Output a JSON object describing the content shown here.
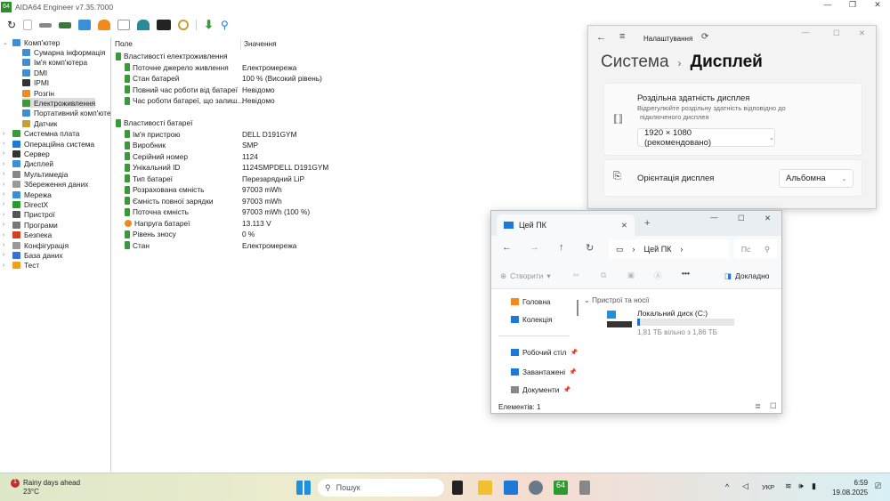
{
  "app": {
    "title": "AIDA64 Engineer v7.35.7000",
    "logo": "64"
  },
  "tree": [
    {
      "label": "Комп'ютер",
      "level": 0,
      "expanded": true,
      "color": "#3a8fd6"
    },
    {
      "label": "Сумарна інформація",
      "level": 1,
      "color": "#3a8fd6"
    },
    {
      "label": "Ім'я комп'ютера",
      "level": 1,
      "color": "#3a8fd6"
    },
    {
      "label": "DMI",
      "level": 1,
      "color": "#3a8fd6"
    },
    {
      "label": "IPMI",
      "level": 1,
      "color": "#333"
    },
    {
      "label": "Розгін",
      "level": 1,
      "color": "#f08a1e"
    },
    {
      "label": "Електроживлення",
      "level": 1,
      "selected": true,
      "color": "#3a9a3a"
    },
    {
      "label": "Портативний комп'юте",
      "level": 1,
      "color": "#3a8fd6"
    },
    {
      "label": "Датчик",
      "level": 1,
      "color": "#c8a030"
    },
    {
      "label": "Системна плата",
      "level": 0,
      "color": "#3a9a3a"
    },
    {
      "label": "Операційна система",
      "level": 0,
      "color": "#1e78d6"
    },
    {
      "label": "Сервер",
      "level": 0,
      "color": "#333"
    },
    {
      "label": "Дисплей",
      "level": 0,
      "color": "#3a8fd6"
    },
    {
      "label": "Мультимедіа",
      "level": 0,
      "color": "#888"
    },
    {
      "label": "Збереження даних",
      "level": 0,
      "color": "#999"
    },
    {
      "label": "Мережа",
      "level": 0,
      "color": "#3a8fd6"
    },
    {
      "label": "DirectX",
      "level": 0,
      "color": "#2a9a2a"
    },
    {
      "label": "Пристрої",
      "level": 0,
      "color": "#555"
    },
    {
      "label": "Програми",
      "level": 0,
      "color": "#777"
    },
    {
      "label": "Безпека",
      "level": 0,
      "color": "#d04020"
    },
    {
      "label": "Конфігурація",
      "level": 0,
      "color": "#999"
    },
    {
      "label": "База даних",
      "level": 0,
      "color": "#3a6fd6"
    },
    {
      "label": "Тест",
      "level": 0,
      "color": "#f0a020"
    }
  ],
  "list": {
    "columns": [
      "Поле",
      "Значення"
    ],
    "rows": [
      {
        "field": "Властивості електроживлення",
        "value": "",
        "group": true
      },
      {
        "field": "Поточне джерело живлення",
        "value": "Електромережа"
      },
      {
        "field": "Стан батарей",
        "value": "100 % (Високий рівень)"
      },
      {
        "field": "Повний час роботи від батареї",
        "value": "Невідомо"
      },
      {
        "field": "Час роботи батареї, що залиш...",
        "value": "Невідомо"
      },
      {
        "field": "",
        "value": "",
        "blank": true
      },
      {
        "field": "Властивості батареї",
        "value": "",
        "group": true
      },
      {
        "field": "Ім'я пристрою",
        "value": "DELL D191GYM"
      },
      {
        "field": "Виробник",
        "value": "SMP"
      },
      {
        "field": "Серійний номер",
        "value": "1124"
      },
      {
        "field": "Унікальний ID",
        "value": "1124SMPDELL D191GYM"
      },
      {
        "field": "Тип батареї",
        "value": "Перезарядний LiP"
      },
      {
        "field": "Розрахована ємність",
        "value": "97003 mWh"
      },
      {
        "field": "Ємність повної зарядки",
        "value": "97003 mWh"
      },
      {
        "field": "Поточна ємність",
        "value": "97003 mWh  (100 %)"
      },
      {
        "field": "Напруга батареї",
        "value": "13.113 V",
        "icon": "voltage"
      },
      {
        "field": "Рівень зносу",
        "value": "0 %"
      },
      {
        "field": "Стан",
        "value": "Електромережа"
      }
    ]
  },
  "settings": {
    "app": "Налаштування",
    "crumb_parent": "Система",
    "crumb_current": "Дисплей",
    "resolution_title": "Роздільна здатність дисплея",
    "resolution_desc1": "Відрегулюйте роздільну здатність відповідно до",
    "resolution_desc2": "підключеного дисплея",
    "resolution_value": "1920 × 1080 (рекомендовано)",
    "orientation_label": "Орієнтація дисплея",
    "orientation_value": "Альбомна"
  },
  "explorer": {
    "tab": "Цей ПК",
    "address": "Цей ПК",
    "search_placeholder": "Пс",
    "new": "Створити",
    "details": "Докладно",
    "nav": [
      "Головна",
      "Колекція",
      "Робочий стіл",
      "Завантажені",
      "Документи"
    ],
    "section": "Пристрої та носії",
    "drive_name": "Локальний диск (C:)",
    "drive_free": "1,81 ТБ вільно з 1,86 ТБ",
    "drive_used_fraction": 0.027,
    "status": "Елементів: 1"
  },
  "taskbar": {
    "weather_title": "Rainy days ahead",
    "weather_temp": "23°C",
    "weather_badge": "1",
    "search": "Пошук",
    "lang": "УКР",
    "time": "6:59",
    "date": "19.08.2025"
  }
}
